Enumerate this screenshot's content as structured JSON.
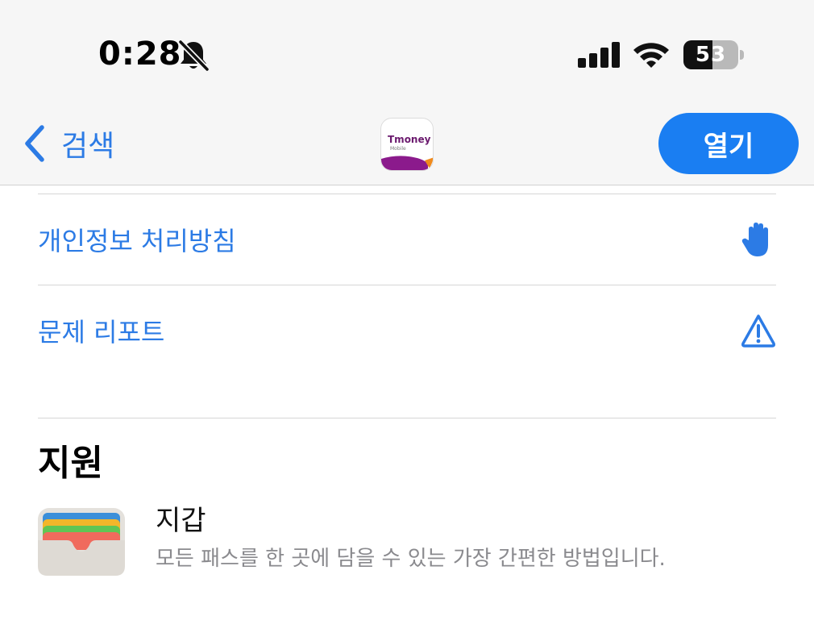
{
  "status_bar": {
    "time": "0:28",
    "battery_level": 53,
    "battery_text": "53",
    "icons": [
      "bell-slash-icon",
      "cellular-signal-icon",
      "wifi-icon",
      "battery-icon"
    ]
  },
  "nav": {
    "back_label": "검색",
    "app_icon": "tmoney-app-icon",
    "app_icon_text": "Tmoney",
    "app_icon_subtext": "Mobile",
    "open_label": "열기"
  },
  "rows": [
    {
      "label": "개인정보 처리방침",
      "icon": "hand-raised-icon"
    },
    {
      "label": "문제 리포트",
      "icon": "exclamation-triangle-icon"
    }
  ],
  "support": {
    "title": "지원",
    "items": [
      {
        "name": "지갑",
        "description": "모든 패스를 한 곳에 담을 수 있는 가장 간편한 방법입니다.",
        "icon": "wallet-app-icon"
      }
    ]
  },
  "colors": {
    "accent": "#2c7be5",
    "open_button": "#1a7ef2",
    "bar_background": "#f6f6f6",
    "secondary_text": "#8a8a8e"
  }
}
